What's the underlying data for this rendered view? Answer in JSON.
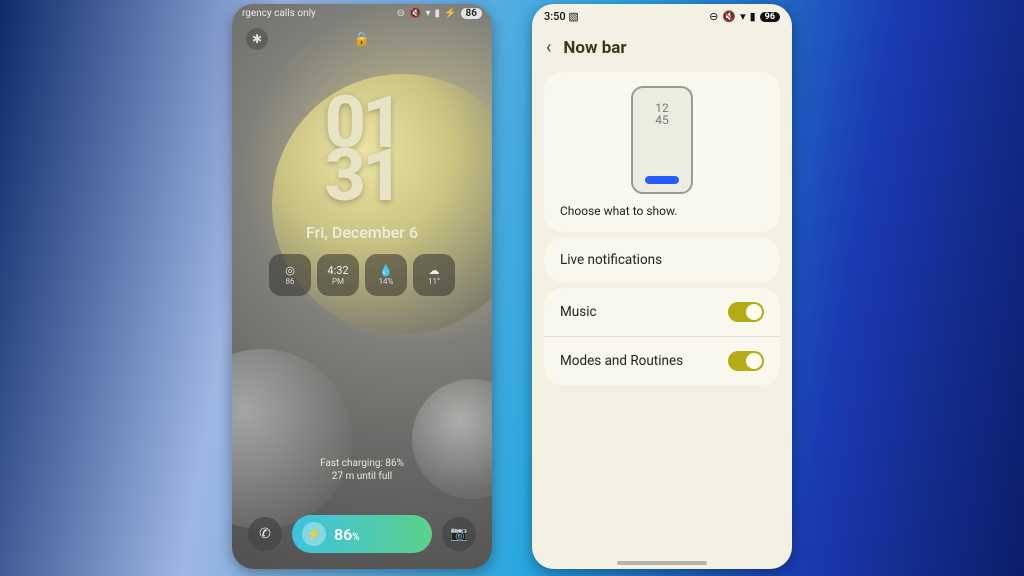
{
  "left": {
    "status": {
      "carrier": "rgency calls only",
      "battery_pill": "86"
    },
    "clock": {
      "a": "01",
      "b": "31"
    },
    "date": "Fri, December 6",
    "widgets": [
      {
        "top": "◎",
        "bot": "86"
      },
      {
        "top": "4:32",
        "bot": "PM"
      },
      {
        "top": "💧",
        "bot": "14%"
      },
      {
        "top": "☁",
        "bot": "11°"
      }
    ],
    "charge": {
      "line1": "Fast charging: 86%",
      "line2": "27 m until full"
    },
    "nowbar": {
      "percent": "86",
      "unit": "%"
    }
  },
  "right": {
    "status": {
      "time": "3:50",
      "battery": "96"
    },
    "title": "Now bar",
    "preview": {
      "clock1": "12",
      "clock2": "45",
      "caption": "Choose what to show."
    },
    "rows": {
      "live": "Live notifications",
      "music": "Music",
      "modes": "Modes and Routines"
    }
  }
}
